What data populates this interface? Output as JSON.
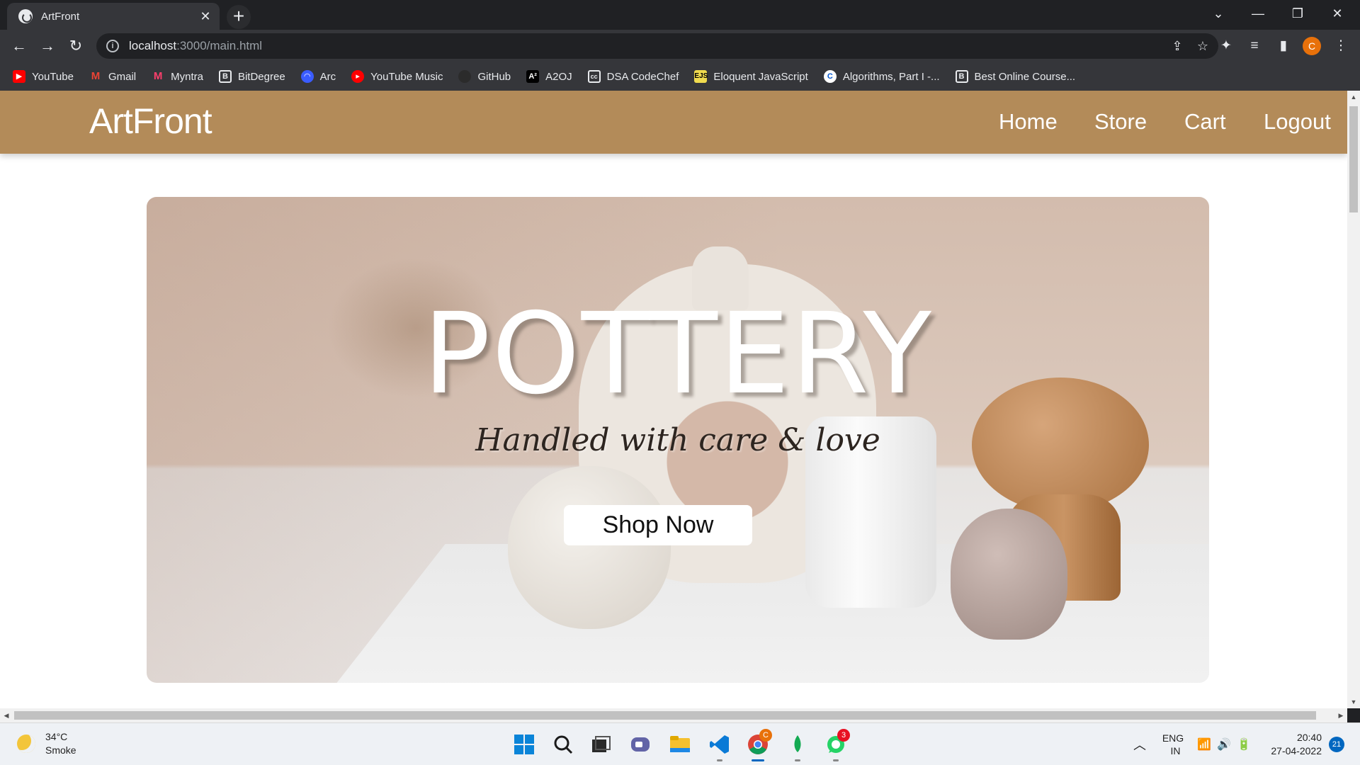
{
  "browser": {
    "tab_title": "ArtFront",
    "tab_close": "✕",
    "new_tab": "+",
    "url_host": "localhost",
    "url_path": ":3000/main.html",
    "profile_initial": "C",
    "bookmarks": [
      {
        "label": "YouTube",
        "icon": "youtube-icon",
        "color": "#ff0000"
      },
      {
        "label": "Gmail",
        "icon": "gmail-icon",
        "color": "#ea4335"
      },
      {
        "label": "Myntra",
        "icon": "myntra-icon",
        "color": "#ff3f6c"
      },
      {
        "label": "BitDegree",
        "icon": "bitdegree-icon",
        "color": "#ffffff"
      },
      {
        "label": "Arc",
        "icon": "arc-icon",
        "color": "#3a5cff"
      },
      {
        "label": "YouTube Music",
        "icon": "youtube-music-icon",
        "color": "#ff0000"
      },
      {
        "label": "GitHub",
        "icon": "github-icon",
        "color": "#2b2b2b"
      },
      {
        "label": "A2OJ",
        "icon": "a2oj-icon",
        "color": "#000000"
      },
      {
        "label": "DSA CodeChef",
        "icon": "codechef-icon",
        "color": "#ffffff"
      },
      {
        "label": "Eloquent JavaScript",
        "icon": "eloquent-js-icon",
        "color": "#f0db4f"
      },
      {
        "label": "Algorithms, Part I -...",
        "icon": "coursera-icon",
        "color": "#0056d2"
      },
      {
        "label": "Best Online Course...",
        "icon": "course-icon",
        "color": "#ffffff"
      }
    ]
  },
  "site": {
    "brand": "ArtFront",
    "header_color": "#b38b59",
    "nav": [
      "Home",
      "Store",
      "Cart",
      "Logout"
    ]
  },
  "hero": {
    "title": "POTTERY",
    "subtitle": "Handled with care & love",
    "cta": "Shop Now"
  },
  "taskbar": {
    "weather_temp": "34°C",
    "weather_desc": "Smoke",
    "lang_top": "ENG",
    "lang_bottom": "IN",
    "time": "20:40",
    "date": "27-04-2022",
    "notification_count": "21",
    "whatsapp_badge": "3"
  }
}
